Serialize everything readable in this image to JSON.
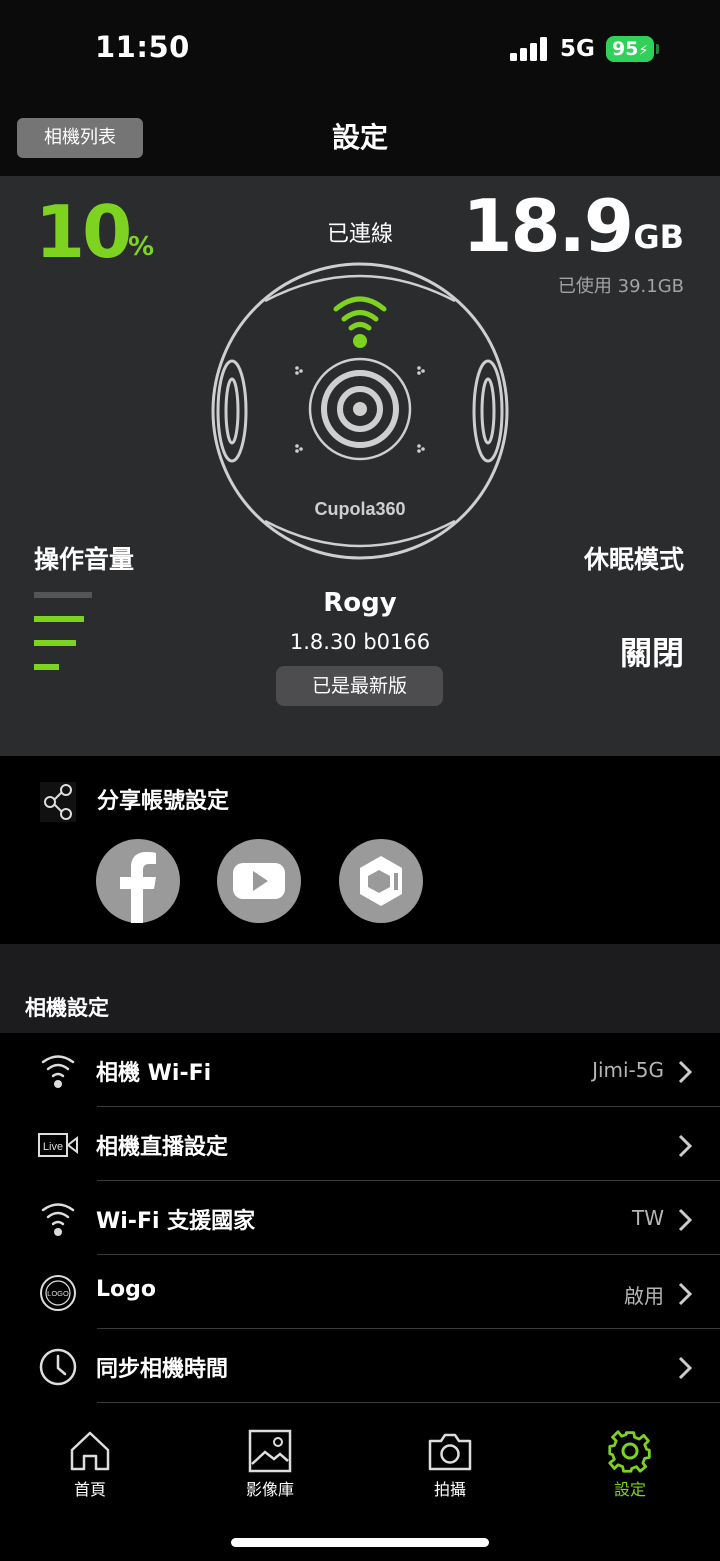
{
  "status_bar": {
    "time": "11:50",
    "network": "5G",
    "battery": "95"
  },
  "header": {
    "camera_list_button": "相機列表",
    "title": "設定"
  },
  "device": {
    "battery_percent": "10",
    "battery_unit": "%",
    "connection_status": "已連線",
    "storage_free": "18.9",
    "storage_unit": "GB",
    "storage_used": "已使用 39.1GB",
    "brand": "Cupola360",
    "name": "Rogy",
    "firmware": "1.8.30 b0166",
    "update_status": "已是最新版",
    "volume_label": "操作音量",
    "volume_level": 3,
    "volume_max": 4,
    "sleep_label": "休眠模式",
    "sleep_value": "關閉"
  },
  "share": {
    "label": "分享帳號設定",
    "accounts": [
      {
        "name": "facebook-icon"
      },
      {
        "name": "youtube-icon"
      },
      {
        "name": "cupola-icon"
      }
    ]
  },
  "camera_settings": {
    "title": "相機設定",
    "items": [
      {
        "label": "相機 Wi-Fi",
        "value": "Jimi-5G",
        "icon": "wifi-icon"
      },
      {
        "label": "相機直播設定",
        "value": "",
        "icon": "live-icon"
      },
      {
        "label": "Wi-Fi 支援國家",
        "value": "TW",
        "icon": "wifi-icon"
      },
      {
        "label": "Logo",
        "value": "啟用",
        "icon": "logo-icon"
      },
      {
        "label": "同步相機時間",
        "value": "",
        "icon": "clock-icon"
      }
    ]
  },
  "tabbar": {
    "tabs": [
      {
        "label": "首頁",
        "icon": "home-icon"
      },
      {
        "label": "影像庫",
        "icon": "gallery-icon"
      },
      {
        "label": "拍攝",
        "icon": "camera-icon"
      },
      {
        "label": "設定",
        "icon": "gear-icon",
        "active": true
      }
    ]
  },
  "colors": {
    "accent": "#7ed321",
    "panel": "#2b2c2e",
    "battery_green": "#30d158"
  }
}
